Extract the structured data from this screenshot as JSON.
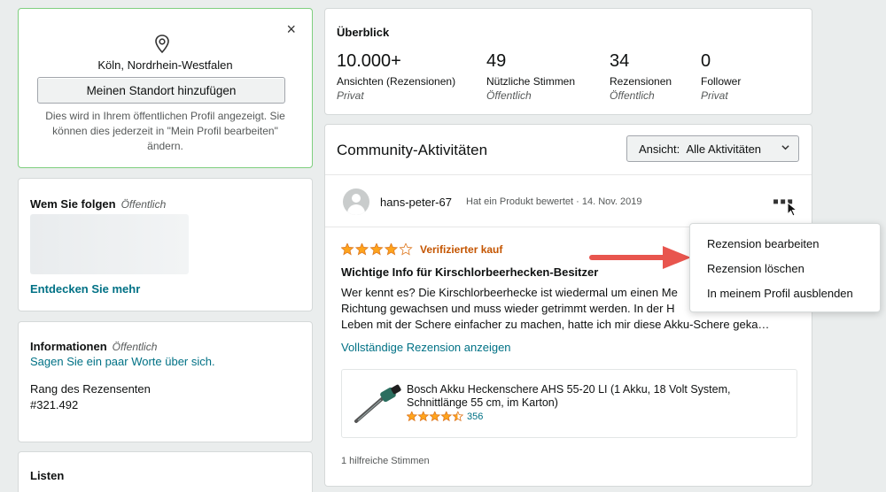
{
  "location": {
    "city": "Köln, Nordrhein-Westfalen",
    "add_button": "Meinen Standort hinzufügen",
    "note": "Dies wird in Ihrem öffentlichen Profil angezeigt. Sie können dies jederzeit in \"Mein Profil bearbeiten\" ändern.",
    "close": "×"
  },
  "follow": {
    "title": "Wem Sie folgen",
    "visibility": "Öffentlich",
    "more_link": "Entdecken Sie mehr"
  },
  "info": {
    "title": "Informationen",
    "visibility": "Öffentlich",
    "prompt_link": "Sagen Sie ein paar Worte über sich.",
    "rank_label": "Rang des Rezensenten",
    "rank_value": "#321.492"
  },
  "lists": {
    "title": "Listen"
  },
  "overview": {
    "title": "Überblick",
    "stats": [
      {
        "value": "10.000+",
        "label": "Ansichten (Rezensionen)",
        "visibility": "Privat"
      },
      {
        "value": "49",
        "label": "Nützliche Stimmen",
        "visibility": "Öffentlich"
      },
      {
        "value": "34",
        "label": "Rezensionen",
        "visibility": "Öffentlich"
      },
      {
        "value": "0",
        "label": "Follower",
        "visibility": "Privat"
      }
    ]
  },
  "community": {
    "title": "Community-Aktivitäten",
    "view_label": "Ansicht:",
    "view_value": "Alle Aktivitäten",
    "activity": {
      "user": "hans-peter-67",
      "action": "Hat ein Produkt bewertet · 14. Nov. 2019",
      "rating": 4,
      "verified": "Verifizierter kauf",
      "review_title": "Wichtige Info für Kirschlorbeerhecken-Besitzer",
      "body_lines": [
        "Wer kennt es? Die Kirschlorbeerhecke ist wiedermal um einen Me",
        "Richtung gewachsen und muss wieder getrimmt werden. In der H",
        "Leben mit der Schere einfacher zu machen, hatte ich mir diese Akku-Schere geka…"
      ],
      "full_review_link": "Vollständige Rezension anzeigen",
      "product": {
        "title": "Bosch Akku Heckenschere AHS 55-20 LI (1 Akku, 18 Volt System, Schnittlänge 55 cm, im Karton)",
        "rating": 4.5,
        "rating_count": "356"
      },
      "helpful": "1 hilfreiche Stimmen"
    },
    "menu": [
      "Rezension bearbeiten",
      "Rezension löschen",
      "In meinem Profil ausblenden"
    ]
  },
  "colors": {
    "accent_link": "#007185",
    "verified": "#c45500",
    "star": "#ffa41c",
    "arrow": "#e8554e",
    "location_border": "#7fcf7f"
  }
}
